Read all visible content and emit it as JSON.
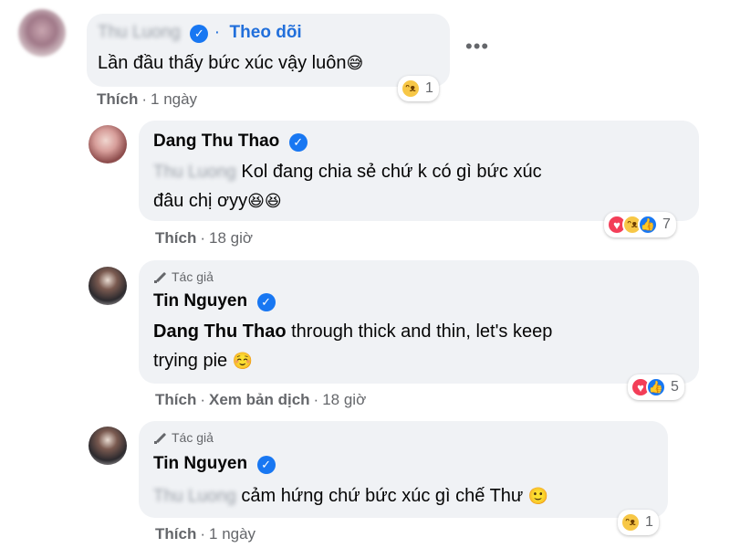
{
  "comments": [
    {
      "author_blurred": "Thu Luong",
      "verified": "✓",
      "follow": "Theo dõi",
      "follow_dot": "·",
      "text": "Lần đầu thấy bức xúc vậy luôn",
      "emoji": "😅",
      "reaction_count": "1",
      "like": "Thích",
      "time": "1 ngày"
    },
    {
      "author": "Dang Thu Thao",
      "verified": "✓",
      "mention_blurred": "Thu Luong",
      "text_line1": "Kol đang chia sẻ chứ k có gì bức xúc",
      "text_line2": "đâu chị ơyy",
      "emoji": "😆😆",
      "reaction_count": "7",
      "like": "Thích",
      "time": "18 giờ"
    },
    {
      "author_badge": "Tác giả",
      "author": "Tin Nguyen",
      "verified": "✓",
      "mention": "Dang Thu Thao",
      "text_line1": " through thick and thin, let's keep",
      "text_line2": "trying pie",
      "emoji": "☺️",
      "reaction_count": "5",
      "like": "Thích",
      "translate": "Xem bản dịch",
      "time": "18 giờ"
    },
    {
      "author_badge": "Tác giả",
      "author": "Tin Nguyen",
      "verified": "✓",
      "mention_blurred": "Thu Luong",
      "text": "cảm hứng chứ bức xúc gì chế Thư",
      "emoji": "🙂",
      "reaction_count": "1",
      "like": "Thích",
      "time": "1 ngày"
    }
  ],
  "icons": {
    "more": "more-options-icon",
    "haha": "haha-reaction-icon",
    "love": "love-reaction-icon",
    "like": "like-reaction-icon",
    "verified": "verified-badge-icon",
    "pen": "pen-icon"
  },
  "colors": {
    "bubble": "#f0f2f5",
    "link": "#216fdb",
    "verified": "#1877f2",
    "muted": "#65676b"
  },
  "more_glyph": "•••",
  "separator": "·"
}
